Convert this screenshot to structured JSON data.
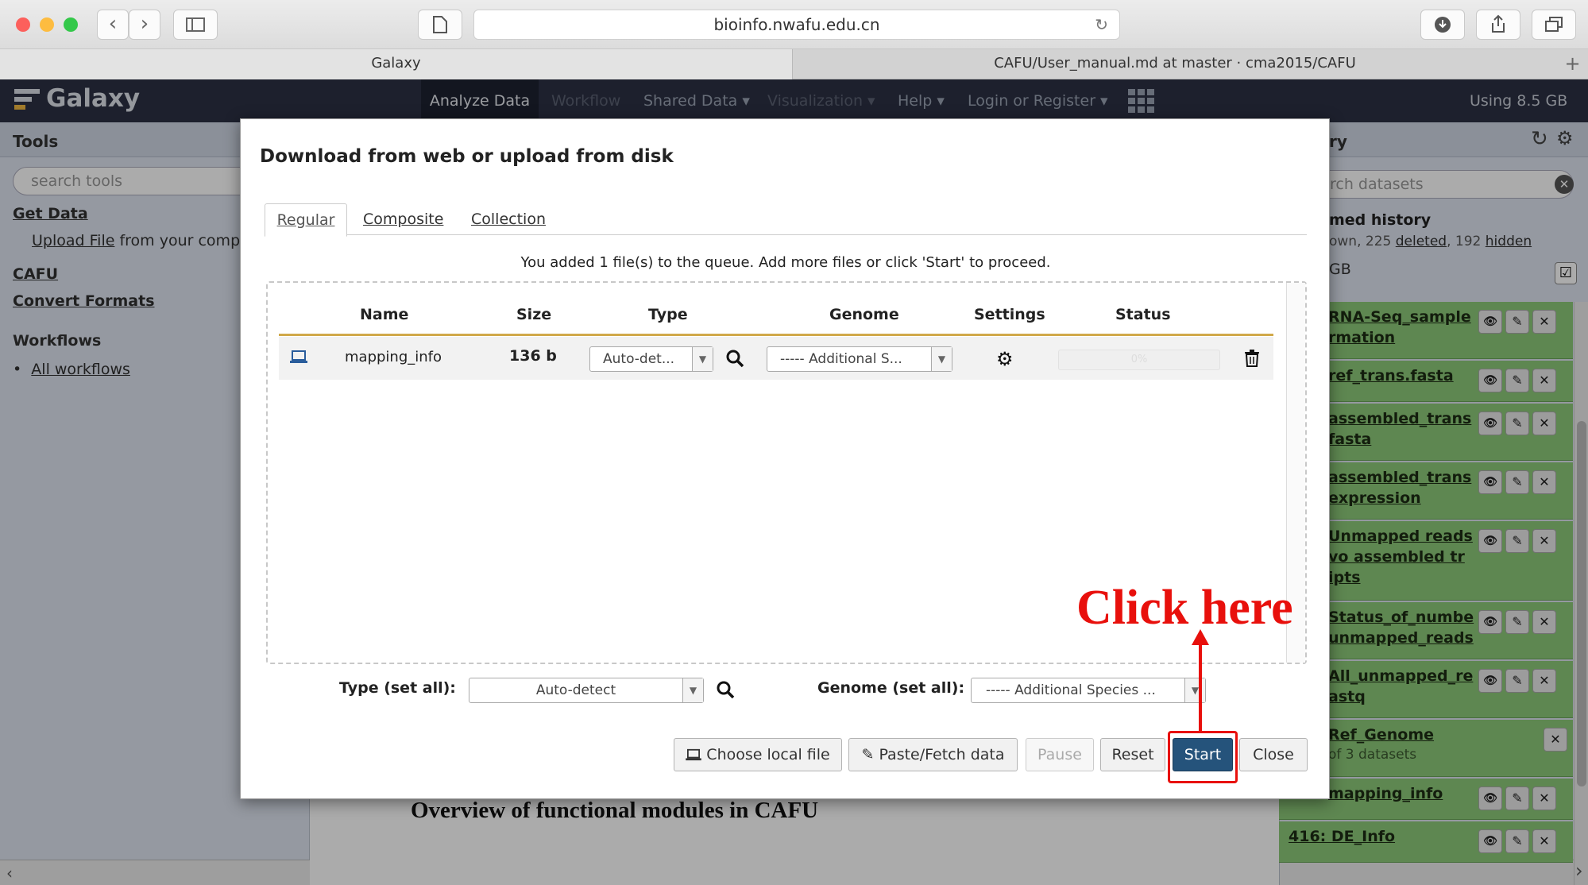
{
  "browser": {
    "url": "bioinfo.nwafu.edu.cn",
    "tabs": [
      "Galaxy",
      "CAFU/User_manual.md at master · cma2015/CAFU"
    ],
    "new_tab": "+"
  },
  "masthead": {
    "brand": "Galaxy",
    "nav": [
      "Analyze Data",
      "Workflow",
      "Shared Data ▾",
      "Visualization ▾",
      "Help ▾",
      "Login or Register ▾"
    ],
    "usage": "Using 8.5 GB"
  },
  "tool_panel": {
    "title": "Tools",
    "search_placeholder": "search tools",
    "get_data": "Get Data",
    "upload_link": "Upload File",
    "upload_rest": "from your compu",
    "cafu": "CAFU",
    "convert": "Convert Formats",
    "workflows_title": "Workflows",
    "all_workflows": "All workflows"
  },
  "history_panel": {
    "title": "ry",
    "search_placeholder": "rch datasets",
    "name": "med history",
    "summary_a": "own, 225 ",
    "deleted": "deleted",
    "summary_b": ", 192 ",
    "hidden": "hidden",
    "size": "GB",
    "items": [
      {
        "line1": "RNA-Seq_sample",
        "line2": "rmation"
      },
      {
        "line1": "ref_trans.fasta",
        "line2": ""
      },
      {
        "line1": "assembled_trans",
        "line2": "fasta"
      },
      {
        "line1": "assembled_trans",
        "line2": "expression"
      },
      {
        "line1": "Unmapped reads",
        "line2": "vo assembled tr",
        "line3": "ipts"
      },
      {
        "line1": "Status_of_numbe",
        "line2": "unmapped_reads"
      },
      {
        "line1": "All_unmapped_re",
        "line2": "astq"
      },
      {
        "line1": "Ref_Genome",
        "line2": "of 3 datasets"
      },
      {
        "line1": "mapping_info",
        "line2": ""
      },
      {
        "line1": "416: DE_Info",
        "line2": ""
      }
    ]
  },
  "center": {
    "heading": "Overview of functional modules in CAFU"
  },
  "modal": {
    "title": "Download from web or upload from disk",
    "tabs": [
      "Regular",
      "Composite",
      "Collection"
    ],
    "message": "You added 1 file(s) to the queue. Add more files or click 'Start' to proceed.",
    "columns": [
      "Name",
      "Size",
      "Type",
      "Genome",
      "Settings",
      "Status"
    ],
    "row": {
      "name": "mapping_info",
      "size": "136 b",
      "type": "Auto-det...",
      "genome": "----- Additional S...",
      "progress": "0%"
    },
    "type_set_all_label": "Type (set all):",
    "type_set_all_value": "Auto-detect",
    "genome_set_all_label": "Genome (set all):",
    "genome_set_all_value": "----- Additional Species ...",
    "buttons": {
      "choose": "Choose local file",
      "paste": "Paste/Fetch data",
      "pause": "Pause",
      "reset": "Reset",
      "start": "Start",
      "close": "Close"
    }
  },
  "annotation": {
    "text": "Click here",
    "color": "#e8100c"
  }
}
